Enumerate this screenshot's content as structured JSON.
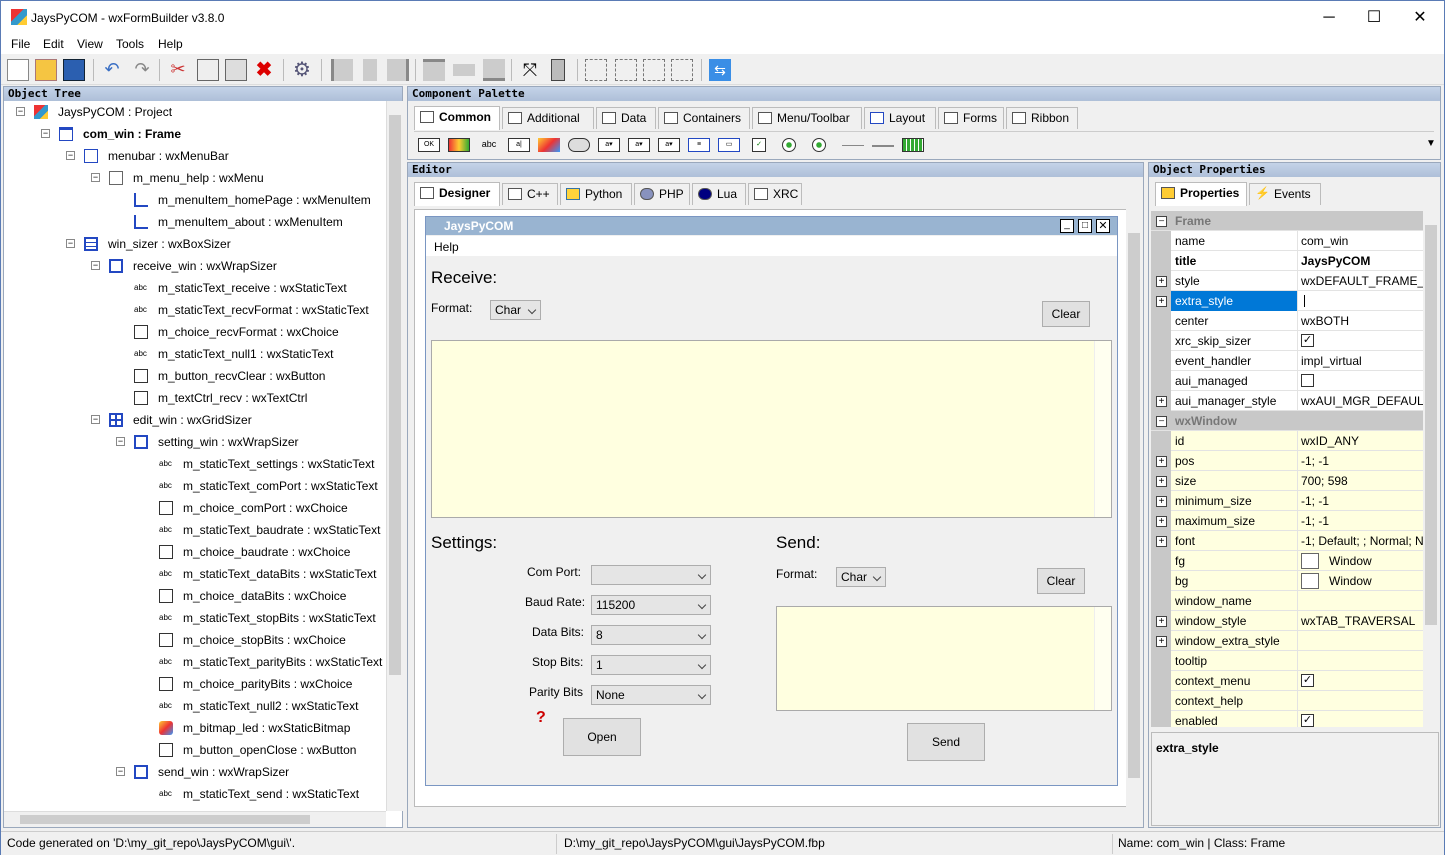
{
  "window": {
    "title": "JaysPyCOM - wxFormBuilder v3.8.0",
    "minimize": "─",
    "maximize": "☐",
    "close": "✕"
  },
  "menu": [
    "File",
    "Edit",
    "View",
    "Tools",
    "Help"
  ],
  "object_tree": {
    "header": "Object Tree",
    "items": [
      {
        "label": "JaysPyCOM : Project",
        "indent": 0,
        "icon": "project-icon"
      },
      {
        "label": "com_win : Frame",
        "indent": 1,
        "icon": "frame-icon",
        "bold": true
      },
      {
        "label": "menubar : wxMenuBar",
        "indent": 2,
        "icon": "menubar-icon"
      },
      {
        "label": "m_menu_help : wxMenu",
        "indent": 3,
        "icon": "menu-icon"
      },
      {
        "label": "m_menuItem_homePage : wxMenuItem",
        "indent": 4,
        "icon": "menuitem-icon"
      },
      {
        "label": "m_menuItem_about : wxMenuItem",
        "indent": 4,
        "icon": "menuitem-icon"
      },
      {
        "label": "win_sizer : wxBoxSizer",
        "indent": 2,
        "icon": "boxsizer-icon"
      },
      {
        "label": "receive_win : wxWrapSizer",
        "indent": 3,
        "icon": "wrapsizer-icon"
      },
      {
        "label": "m_staticText_receive : wxStaticText",
        "indent": 4,
        "icon": "abc"
      },
      {
        "label": "m_staticText_recvFormat : wxStaticText",
        "indent": 4,
        "icon": "abc"
      },
      {
        "label": "m_choice_recvFormat : wxChoice",
        "indent": 4,
        "icon": "choice-icon"
      },
      {
        "label": "m_staticText_null1 : wxStaticText",
        "indent": 4,
        "icon": "abc"
      },
      {
        "label": "m_button_recvClear : wxButton",
        "indent": 4,
        "icon": "button-icon"
      },
      {
        "label": "m_textCtrl_recv : wxTextCtrl",
        "indent": 4,
        "icon": "textctrl-icon"
      },
      {
        "label": "edit_win : wxGridSizer",
        "indent": 3,
        "icon": "gridsizer-icon"
      },
      {
        "label": "setting_win : wxWrapSizer",
        "indent": 4,
        "icon": "wrapsizer-icon"
      },
      {
        "label": "m_staticText_settings : wxStaticText",
        "indent": 5,
        "icon": "abc"
      },
      {
        "label": "m_staticText_comPort : wxStaticText",
        "indent": 5,
        "icon": "abc"
      },
      {
        "label": "m_choice_comPort : wxChoice",
        "indent": 5,
        "icon": "choice-icon"
      },
      {
        "label": "m_staticText_baudrate : wxStaticText",
        "indent": 5,
        "icon": "abc"
      },
      {
        "label": "m_choice_baudrate : wxChoice",
        "indent": 5,
        "icon": "choice-icon"
      },
      {
        "label": "m_staticText_dataBits : wxStaticText",
        "indent": 5,
        "icon": "abc"
      },
      {
        "label": "m_choice_dataBits : wxChoice",
        "indent": 5,
        "icon": "choice-icon"
      },
      {
        "label": "m_staticText_stopBits : wxStaticText",
        "indent": 5,
        "icon": "abc"
      },
      {
        "label": "m_choice_stopBits : wxChoice",
        "indent": 5,
        "icon": "choice-icon"
      },
      {
        "label": "m_staticText_parityBits : wxStaticText",
        "indent": 5,
        "icon": "abc"
      },
      {
        "label": "m_choice_parityBits : wxChoice",
        "indent": 5,
        "icon": "choice-icon"
      },
      {
        "label": "m_staticText_null2 : wxStaticText",
        "indent": 5,
        "icon": "abc"
      },
      {
        "label": "m_bitmap_led : wxStaticBitmap",
        "indent": 5,
        "icon": "bitmap-icon"
      },
      {
        "label": "m_button_openClose : wxButton",
        "indent": 5,
        "icon": "button-icon"
      },
      {
        "label": "send_win : wxWrapSizer",
        "indent": 4,
        "icon": "wrapsizer-icon"
      },
      {
        "label": "m_staticText_send : wxStaticText",
        "indent": 5,
        "icon": "abc"
      }
    ]
  },
  "palette": {
    "header": "Component Palette",
    "tabs": [
      "Common",
      "Additional",
      "Data",
      "Containers",
      "Menu/Toolbar",
      "Layout",
      "Forms",
      "Ribbon"
    ]
  },
  "editor": {
    "header": "Editor",
    "tabs": [
      "Designer",
      "C++",
      "Python",
      "PHP",
      "Lua",
      "XRC"
    ],
    "form": {
      "title": "JaysPyCOM",
      "menu": "Help",
      "receive_label": "Receive:",
      "format_label": "Format:",
      "recv_format": "Char",
      "clear_label": "Clear",
      "settings_label": "Settings:",
      "send_label": "Send:",
      "com_port_label": "Com Port:",
      "com_port_value": "",
      "baud_label": "Baud Rate:",
      "baud_value": "115200",
      "data_bits_label": "Data Bits:",
      "data_bits_value": "8",
      "stop_bits_label": "Stop Bits:",
      "stop_bits_value": "1",
      "parity_label": "Parity Bits",
      "parity_value": "None",
      "open_label": "Open",
      "send_format": "Char",
      "send_button": "Send",
      "unknown_glyph": "?"
    }
  },
  "properties": {
    "header": "Object Properties",
    "tabs": [
      "Properties",
      "Events"
    ],
    "rows": [
      {
        "type": "cat",
        "name": "Frame"
      },
      {
        "name": "name",
        "value": "com_win"
      },
      {
        "name": "title",
        "value": "JaysPyCOM",
        "bold": true
      },
      {
        "name": "style",
        "value": "wxDEFAULT_FRAME_ST",
        "expand": true
      },
      {
        "name": "extra_style",
        "value": "",
        "expand": true,
        "selected": true
      },
      {
        "name": "center",
        "value": "wxBOTH"
      },
      {
        "name": "xrc_skip_sizer",
        "check": true
      },
      {
        "name": "event_handler",
        "value": "impl_virtual"
      },
      {
        "name": "aui_managed",
        "check": false
      },
      {
        "name": "aui_manager_style",
        "value": "wxAUI_MGR_DEFAULT",
        "expand": true
      },
      {
        "type": "cat",
        "name": "wxWindow"
      },
      {
        "name": "id",
        "value": "wxID_ANY",
        "yellow": true
      },
      {
        "name": "pos",
        "value": "-1; -1",
        "expand": true,
        "yellow": true
      },
      {
        "name": "size",
        "value": "700; 598",
        "expand": true,
        "yellow": true
      },
      {
        "name": "minimum_size",
        "value": "-1; -1",
        "expand": true,
        "yellow": true
      },
      {
        "name": "maximum_size",
        "value": "-1; -1",
        "expand": true,
        "yellow": true
      },
      {
        "name": "font",
        "value": "-1; Default; ; Normal; N",
        "expand": true,
        "yellow": true
      },
      {
        "name": "fg",
        "value": "Window",
        "swatch": true,
        "yellow": true
      },
      {
        "name": "bg",
        "value": "Window",
        "swatch": true,
        "yellow": true
      },
      {
        "name": "window_name",
        "value": "",
        "yellow": true
      },
      {
        "name": "window_style",
        "value": "wxTAB_TRAVERSAL",
        "expand": true,
        "yellow": true
      },
      {
        "name": "window_extra_style",
        "value": "",
        "expand": true,
        "yellow": true
      },
      {
        "name": "tooltip",
        "value": "",
        "yellow": true
      },
      {
        "name": "context_menu",
        "check": true,
        "yellow": true
      },
      {
        "name": "context_help",
        "value": "",
        "yellow": true
      },
      {
        "name": "enabled",
        "check": true,
        "yellow": true
      }
    ],
    "help_title": "extra_style"
  },
  "status": {
    "left": "Code generated on 'D:\\my_git_repo\\JaysPyCOM\\gui\\'.",
    "middle": "D:\\my_git_repo\\JaysPyCOM\\gui\\JaysPyCOM.fbp",
    "right": "Name: com_win | Class: Frame"
  },
  "colors": {
    "accent": "#0078d7",
    "yellow": "#ffffe0",
    "panel_header": "#aebfd8"
  }
}
